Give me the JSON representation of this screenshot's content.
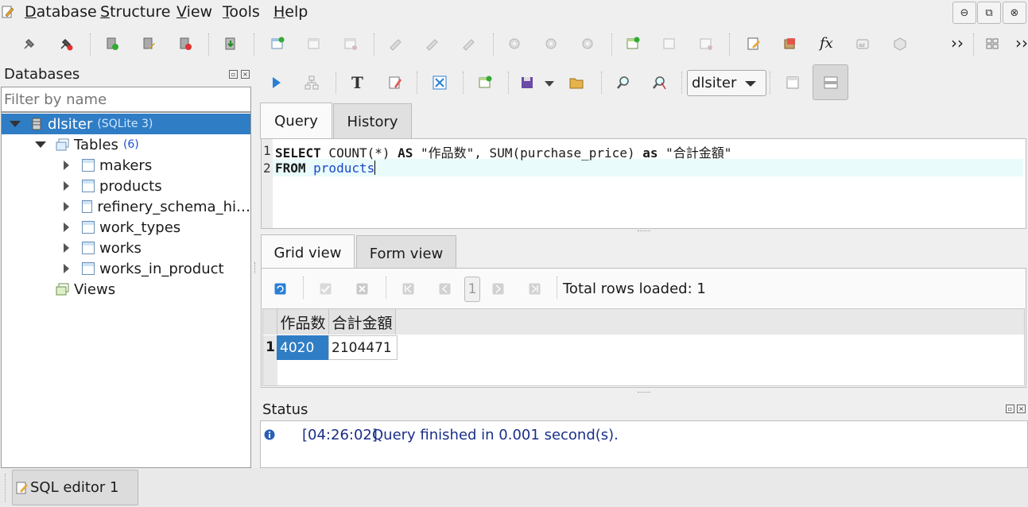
{
  "menubar": {
    "items": [
      {
        "label": "Database",
        "u": "D",
        "rest": "atabase"
      },
      {
        "label": "Structure",
        "u": "S",
        "rest": "tructure"
      },
      {
        "label": "View",
        "u": "V",
        "rest": "iew"
      },
      {
        "label": "Tools",
        "u": "T",
        "rest": "ools"
      },
      {
        "label": "Help",
        "u": "H",
        "rest": "elp"
      }
    ]
  },
  "toolbar": {
    "icons": [
      "connect-icon",
      "disconnect-icon",
      "add-database-icon",
      "edit-database-icon",
      "remove-database-icon",
      "import-icon",
      "create-table-icon",
      "edit-table-icon",
      "delete-table-icon",
      "create-index-icon",
      "edit-index-icon",
      "delete-index-icon",
      "create-trigger-icon",
      "edit-trigger-icon",
      "delete-trigger-icon",
      "create-view-icon",
      "edit-view-icon",
      "delete-view-icon",
      "open-sql-editor-icon",
      "export-icon",
      "function-editor-icon",
      "collation-editor-icon",
      "extension-manager-icon"
    ],
    "more_glyph": "››"
  },
  "databases_panel": {
    "title": "Databases",
    "filter_placeholder": "Filter by name",
    "db_name": "dlsiter",
    "db_type": "(SQLite 3)",
    "tables_label": "Tables",
    "tables_count": "(6)",
    "tables": [
      "makers",
      "products",
      "refinery_schema_hi…",
      "work_types",
      "works",
      "works_in_product"
    ],
    "views_label": "Views"
  },
  "editor_toolbar": {
    "database_select": "dlsiter"
  },
  "tabs": {
    "query": "Query",
    "history": "History"
  },
  "editor": {
    "line1_num": "1",
    "line2_num": "2",
    "l1_kw1": "SELECT",
    "l1_part1": " COUNT(*) ",
    "l1_kw2": "AS",
    "l1_part2": " \"作品数\", SUM(purchase_price) ",
    "l1_kw3": "as",
    "l1_part3": " \"合計金額\"",
    "l2_kw": "FROM",
    "l2_table": " products"
  },
  "result_tabs": {
    "grid": "Grid view",
    "form": "Form view"
  },
  "results": {
    "page_number": "1",
    "total_rows": "Total rows loaded: 1",
    "columns": [
      "作品数",
      "合計金額"
    ],
    "row_num": "1",
    "row": [
      "4020",
      "2104471"
    ]
  },
  "status": {
    "title": "Status",
    "time": "[04:26:02]",
    "message": "Query finished in 0.001 second(s)."
  },
  "bottom": {
    "tab_label": "SQL editor 1"
  }
}
